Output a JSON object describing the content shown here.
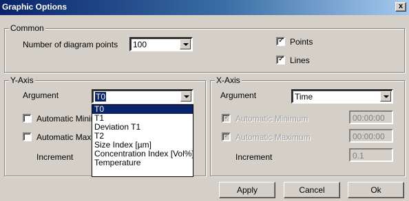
{
  "window": {
    "title": "Graphic Options",
    "close_glyph": "x"
  },
  "common": {
    "legend": "Common",
    "points_label": "Number of diagram points",
    "points_value": "100",
    "points_checkbox": {
      "label": "Points",
      "checked": true
    },
    "lines_checkbox": {
      "label": "Lines",
      "checked": true
    }
  },
  "yaxis": {
    "legend": "Y-Axis",
    "argument_label": "Argument",
    "argument_value": "T0",
    "auto_min_label": "Automatic Minimum",
    "auto_max_label": "Automatic Maximum",
    "increment_label": "Increment",
    "dropdown_options": [
      "T0",
      "T1",
      "Deviation T1",
      "T2",
      "Size Index [µm]",
      "Concentration Index [Vol%]",
      "Temperature"
    ]
  },
  "xaxis": {
    "legend": "X-Axis",
    "argument_label": "Argument",
    "argument_value": "Time",
    "auto_min_label": "Automatic Minimum",
    "auto_min_value": "00:00:00",
    "auto_max_label": "Automatic Maximum",
    "auto_max_value": "00:00:00",
    "increment_label": "Increment",
    "increment_value": "0.1"
  },
  "buttons": {
    "apply": "Apply",
    "cancel": "Cancel",
    "ok": "Ok"
  }
}
